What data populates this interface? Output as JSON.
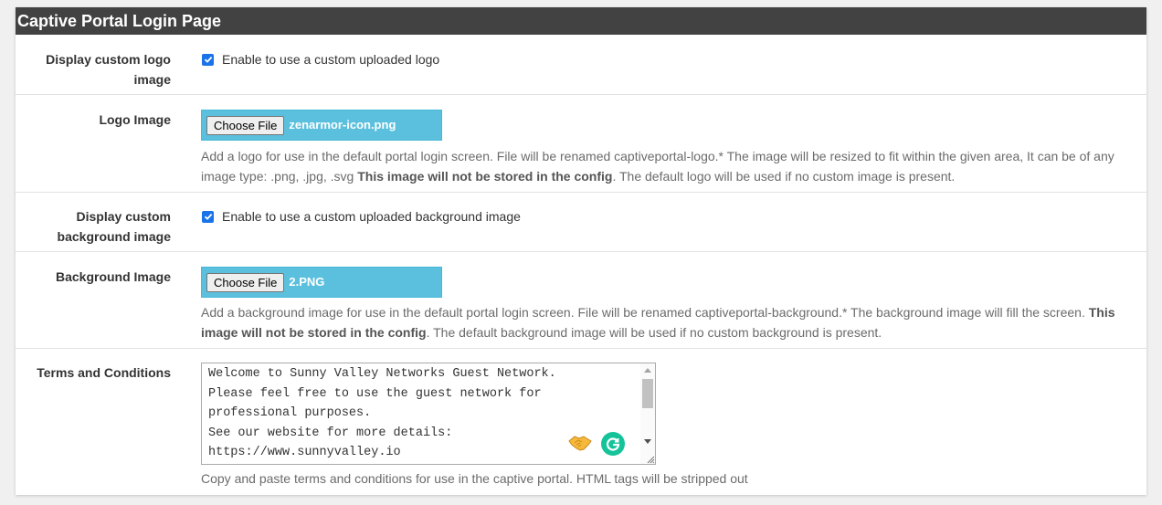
{
  "panel": {
    "title": "Captive Portal Login Page"
  },
  "rows": {
    "custom_logo": {
      "label": "Display custom logo image",
      "checkbox_checked": true,
      "checkbox_label": "Enable to use a custom uploaded logo"
    },
    "logo_image": {
      "label": "Logo Image",
      "button_label": "Choose File",
      "file_name": "zenarmor-icon.png",
      "help_pre": "Add a logo for use in the default portal login screen. File will be renamed captiveportal-logo.* The image will be resized to fit within the given area, It can be of any image type: .png, .jpg, .svg ",
      "help_bold": "This image will not be stored in the config",
      "help_post": ". The default logo will be used if no custom image is present."
    },
    "custom_background": {
      "label": "Display custom background image",
      "checkbox_checked": true,
      "checkbox_label": "Enable to use a custom uploaded background image"
    },
    "background_image": {
      "label": "Background Image",
      "button_label": "Choose File",
      "file_name": "2.PNG",
      "help_pre": "Add a background image for use in the default portal login screen. File will be renamed captiveportal-background.* The background image will fill the screen. ",
      "help_bold": "This image will not be stored in the config",
      "help_post": ". The default background image will be used if no custom background is present."
    },
    "terms": {
      "label": "Terms and Conditions",
      "value": "Welcome to Sunny Valley Networks Guest Network.\nPlease feel free to use the guest network for\nprofessional purposes.\nSee our website for more details:\nhttps://www.sunnyvalley.io",
      "help": "Copy and paste terms and conditions for use in the captive portal. HTML tags will be stripped out"
    }
  },
  "icons": {
    "checkbox": "checkmark-icon",
    "emoji": "handshake-icon",
    "grammarly": "grammarly-icon",
    "resize": "resize-grip-icon"
  },
  "colors": {
    "header_bg": "#424242",
    "file_input_bg": "#5bc0de",
    "checkbox_blue": "#1a73e8",
    "grammarly_green": "#15c39a"
  }
}
